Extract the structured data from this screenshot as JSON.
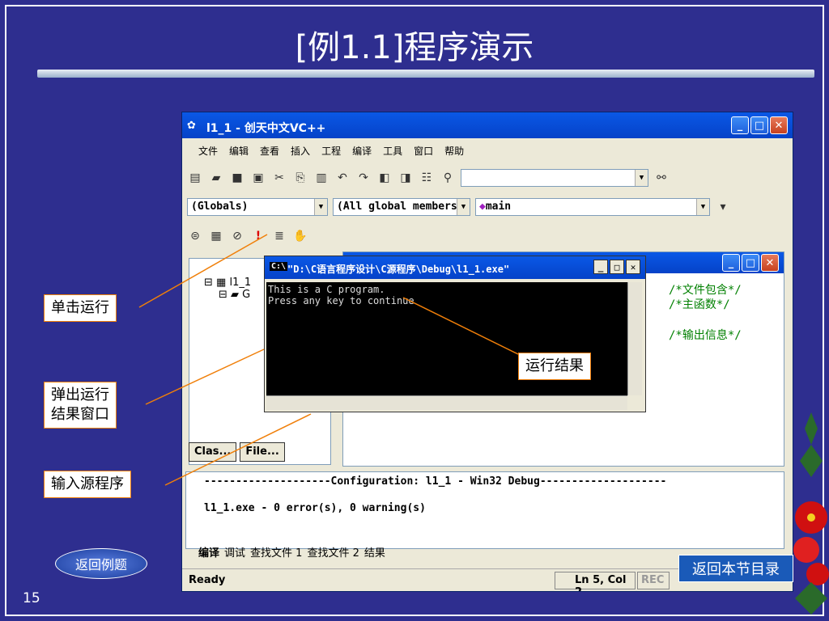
{
  "slide": {
    "title": "[例1.1]程序演示",
    "page_number": "15",
    "return_example_label": "返回例题",
    "return_toc_label": "返回本节目录"
  },
  "ide": {
    "window_title": "l1_1 - 创天中文VC++",
    "menu": [
      "文件",
      "编辑",
      "查看",
      "插入",
      "工程",
      "编译",
      "工具",
      "窗口",
      "帮助"
    ],
    "combo_globals": "(Globals)",
    "combo_members": "(All global members",
    "combo_func": "main",
    "tree_root": "l1_1",
    "tree_child": "G",
    "tab_class": "Clas...",
    "tab_file": "File...",
    "comments": [
      "/*文件包含*/",
      "/*主函数*/",
      "/*输出信息*/"
    ],
    "output_line1": "--------------------Configuration: l1_1 - Win32 Debug--------------------",
    "output_line2": "l1_1.exe - 0 error(s), 0 warning(s)",
    "output_tabs": [
      "编译",
      "调试",
      "查找文件 1",
      "查找文件 2",
      "结果"
    ],
    "status_ready": "Ready",
    "status_pos": "Ln 5, Col 2",
    "status_rec": "REC"
  },
  "console": {
    "title": "\"D:\\C语言程序设计\\C源程序\\Debug\\l1_1.exe\"",
    "line1": "This is a C program.",
    "line2": "Press any key to continue"
  },
  "callouts": {
    "run": "单击运行",
    "popup": "弹出运行结果窗口",
    "popup_line1": "弹出运行",
    "popup_line2": "结果窗口",
    "input_source": "输入源程序",
    "result": "运行结果"
  },
  "colors": {
    "slide_bg": "#2e2e8f",
    "xp_blue": "#0a58e6",
    "callout_border": "#f07f09",
    "comment_green": "#008000"
  }
}
